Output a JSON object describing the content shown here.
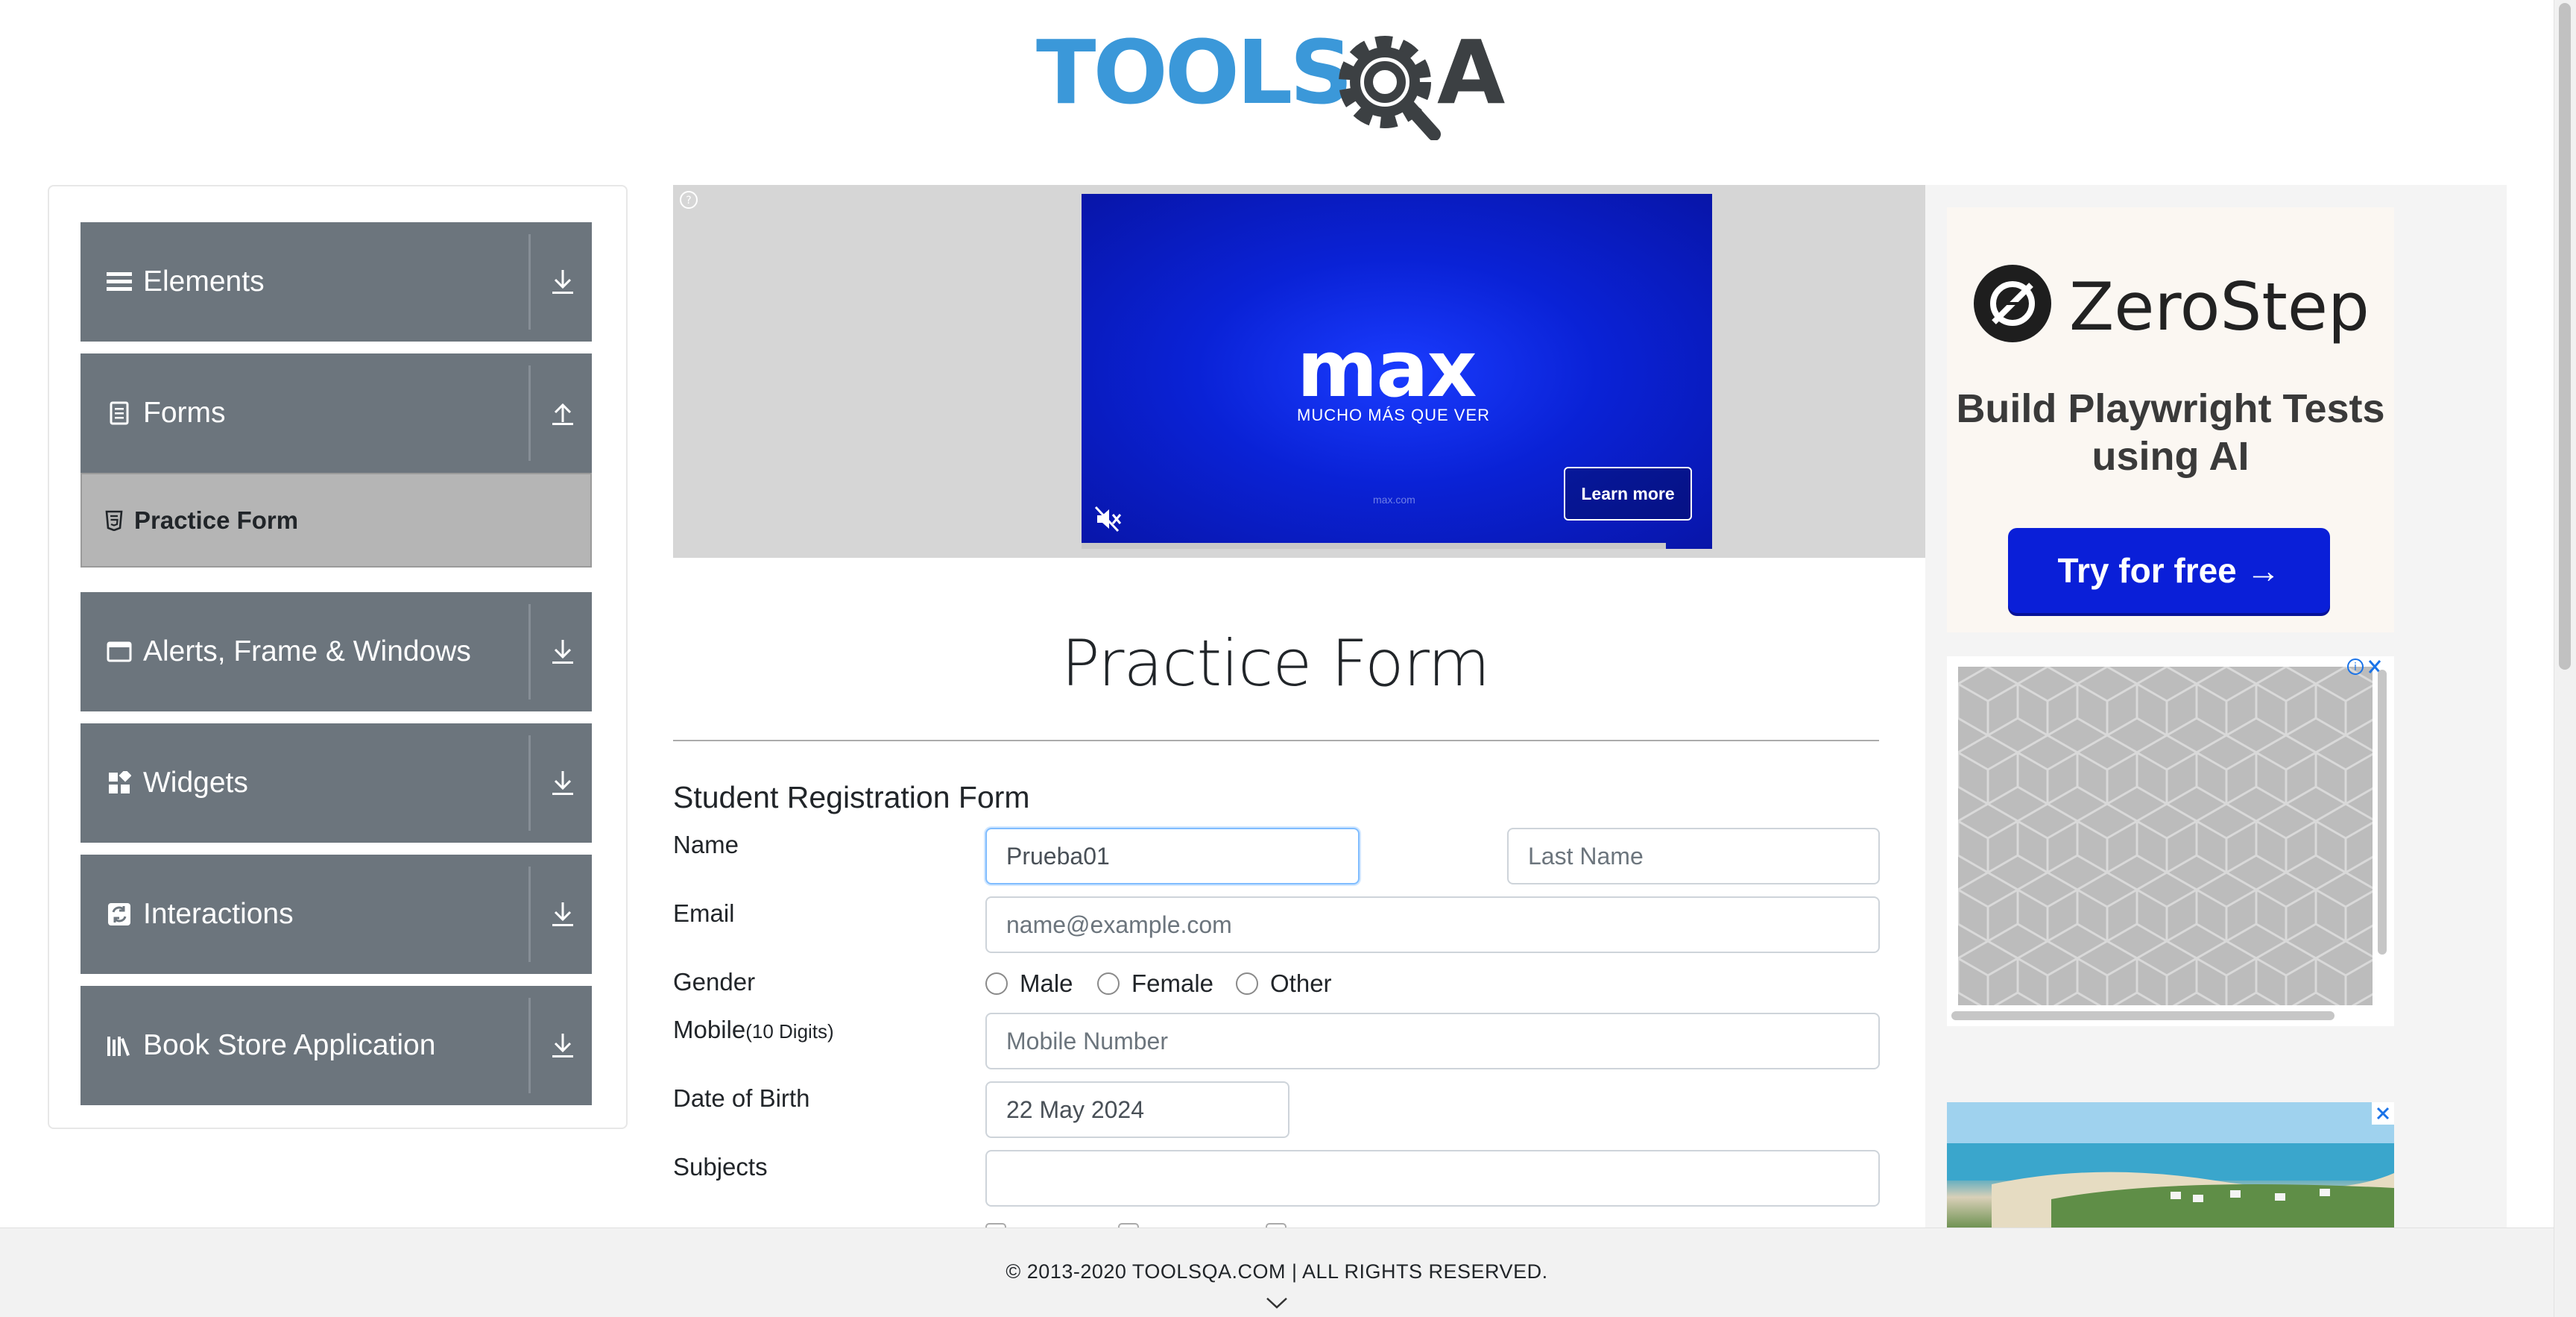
{
  "header": {
    "logo_text_tools": "TOOLS",
    "logo_text_qa": "QA"
  },
  "sidebar": {
    "groups": [
      {
        "label": "Elements",
        "icon": "hamburger-icon",
        "state": "collapsed"
      },
      {
        "label": "Forms",
        "icon": "document-icon",
        "state": "expanded"
      },
      {
        "label": "Alerts, Frame & Windows",
        "icon": "window-icon",
        "state": "collapsed"
      },
      {
        "label": "Widgets",
        "icon": "widgets-icon",
        "state": "collapsed"
      },
      {
        "label": "Interactions",
        "icon": "interactions-icon",
        "state": "collapsed"
      },
      {
        "label": "Book Store Application",
        "icon": "books-icon",
        "state": "collapsed"
      }
    ],
    "active_item": {
      "label": "Practice Form",
      "icon": "html5-icon"
    }
  },
  "ad_banner": {
    "brand": "max",
    "tagline": "MUCHO MÁS QUE VER",
    "url": "max.com",
    "cta": "Learn more"
  },
  "page": {
    "title": "Practice Form"
  },
  "form": {
    "heading": "Student Registration Form",
    "name_label": "Name",
    "first_name_value": "Prueba01",
    "last_name_placeholder": "Last Name",
    "email_label": "Email",
    "email_placeholder": "name@example.com",
    "gender_label": "Gender",
    "gender_options": [
      "Male",
      "Female",
      "Other"
    ],
    "mobile_label": "Mobile",
    "mobile_hint": "(10 Digits)",
    "mobile_placeholder": "Mobile Number",
    "dob_label": "Date of Birth",
    "dob_value": "22 May 2024",
    "subjects_label": "Subjects",
    "subjects_value": ""
  },
  "right_ad": {
    "brand": "ZeroStep",
    "tagline": "Build Playwright Tests using AI",
    "cta": "Try for free →"
  },
  "footer": {
    "text": "© 2013-2020 TOOLSQA.COM | ALL RIGHTS RESERVED."
  },
  "colors": {
    "sidebar_group_bg": "#6c757d",
    "active_item_bg": "#b5b5b5",
    "logo_blue": "#3b98d9",
    "logo_dark": "#3c4043",
    "max_blue": "#0a22d6",
    "zerostep_button": "#0a1fd8"
  }
}
